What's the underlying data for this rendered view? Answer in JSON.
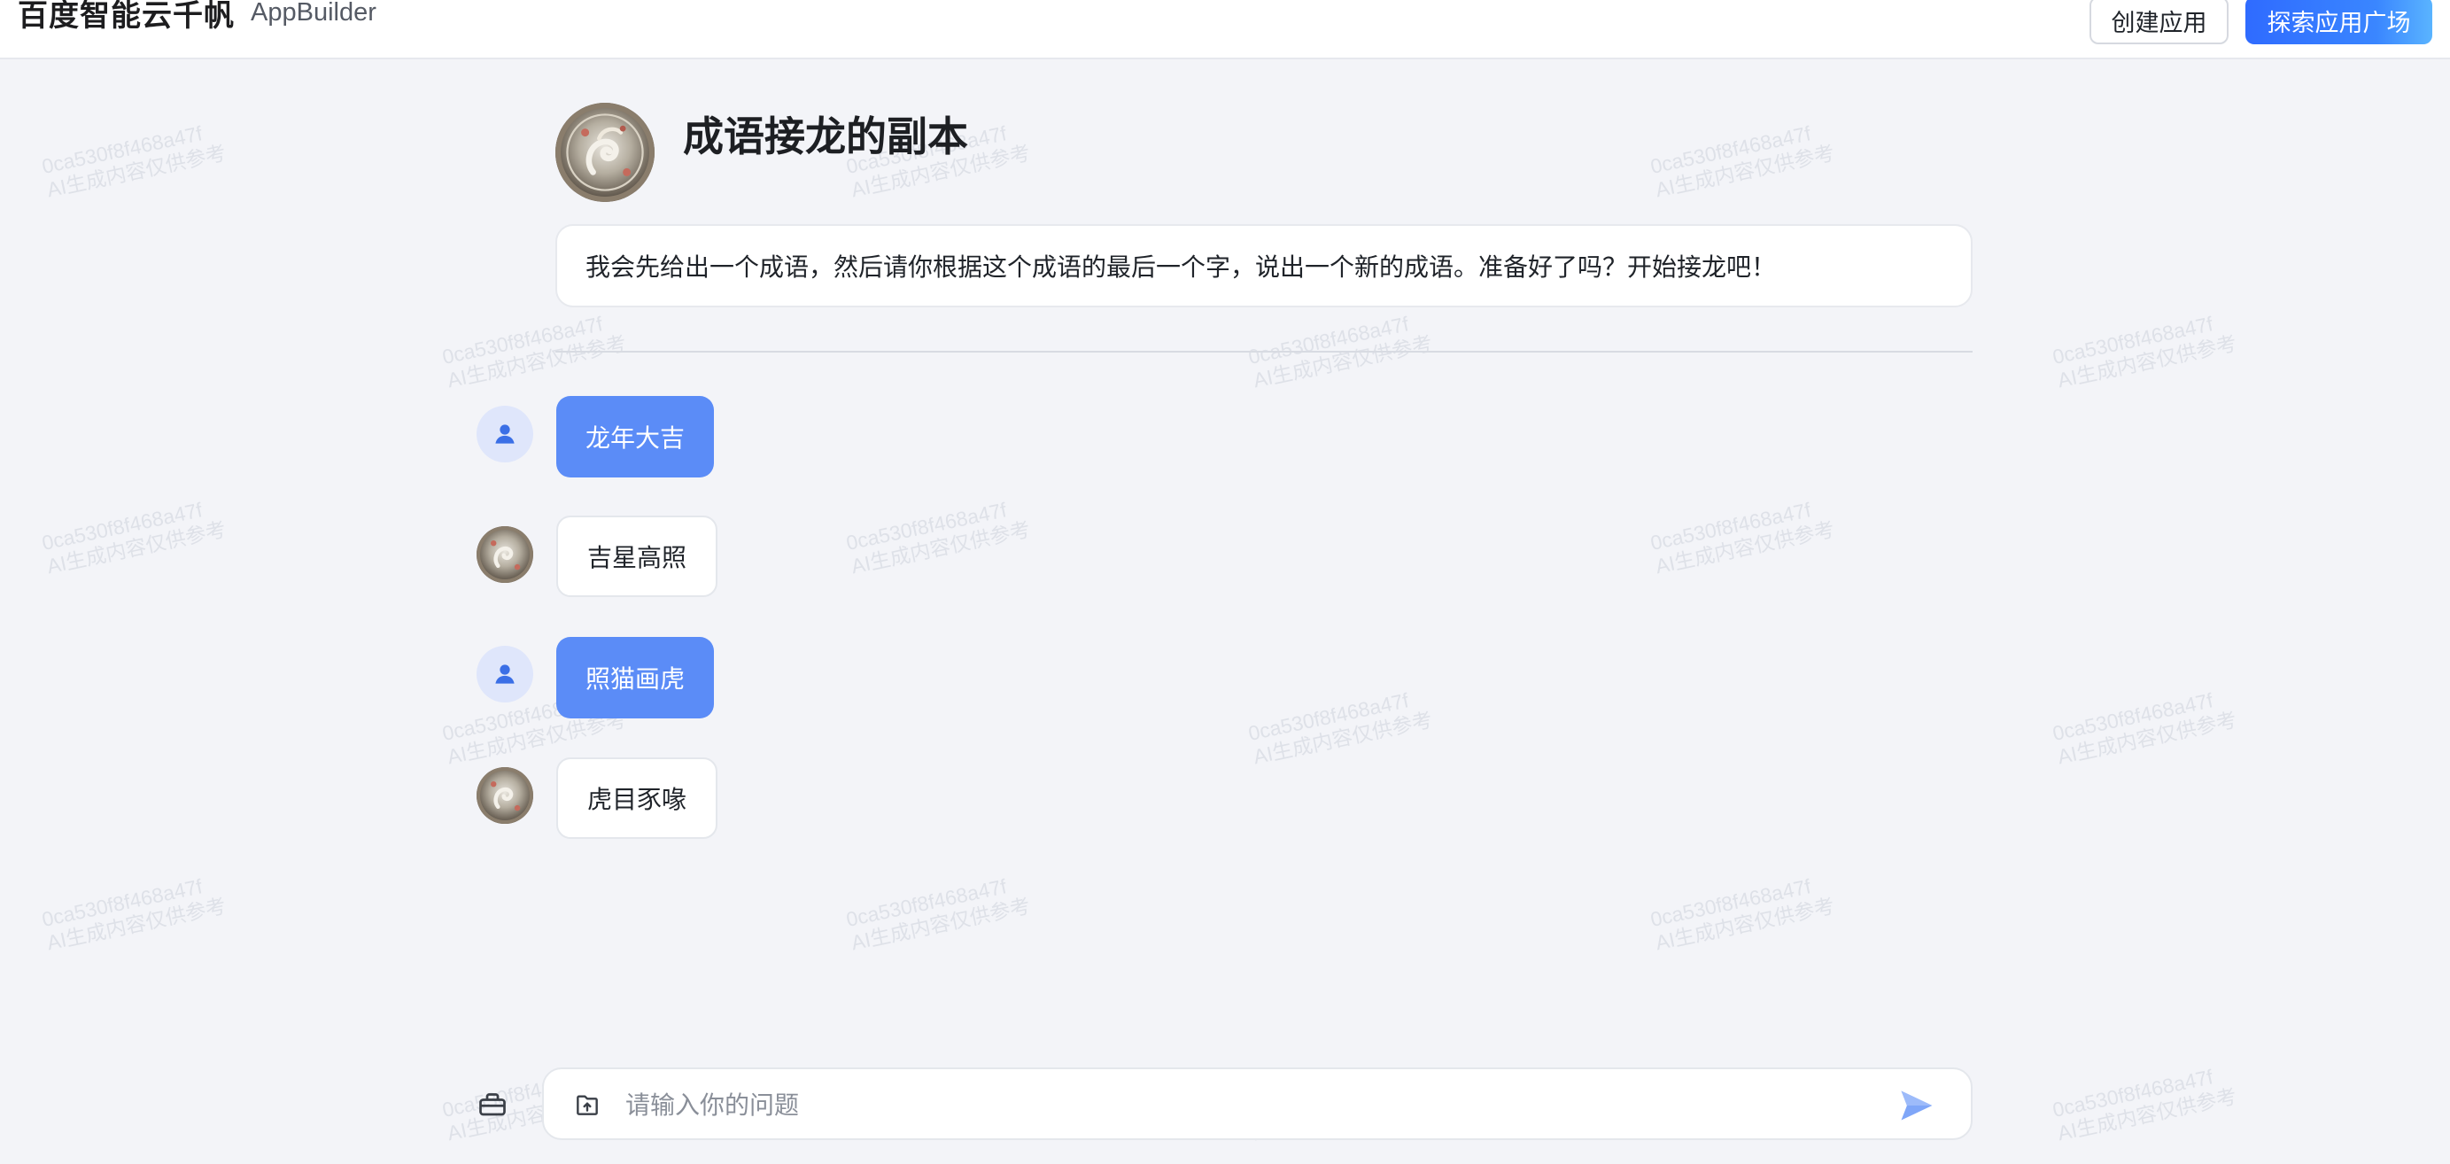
{
  "header": {
    "brand_name": "百度智能云千帆",
    "brand_sub": "AppBuilder",
    "create_app_label": "创建应用",
    "explore_label": "探索应用广场"
  },
  "watermark": {
    "line1": "0ca530f8f468a47f",
    "line2": "AI生成内容仅供参考"
  },
  "app": {
    "title": "成语接龙的副本",
    "intro": "我会先给出一个成语，然后请你根据这个成语的最后一个字，说出一个新的成语。准备好了吗？开始接龙吧！"
  },
  "messages": [
    {
      "role": "user",
      "text": "龙年大吉"
    },
    {
      "role": "bot",
      "text": "吉星高照"
    },
    {
      "role": "user",
      "text": "照猫画虎"
    },
    {
      "role": "bot",
      "text": "虎目豕喙"
    }
  ],
  "input": {
    "placeholder": "请输入你的问题"
  },
  "colors": {
    "accent": "#2f6bff",
    "user_bubble": "#5b8cf7",
    "page_bg": "#f3f4f8"
  }
}
